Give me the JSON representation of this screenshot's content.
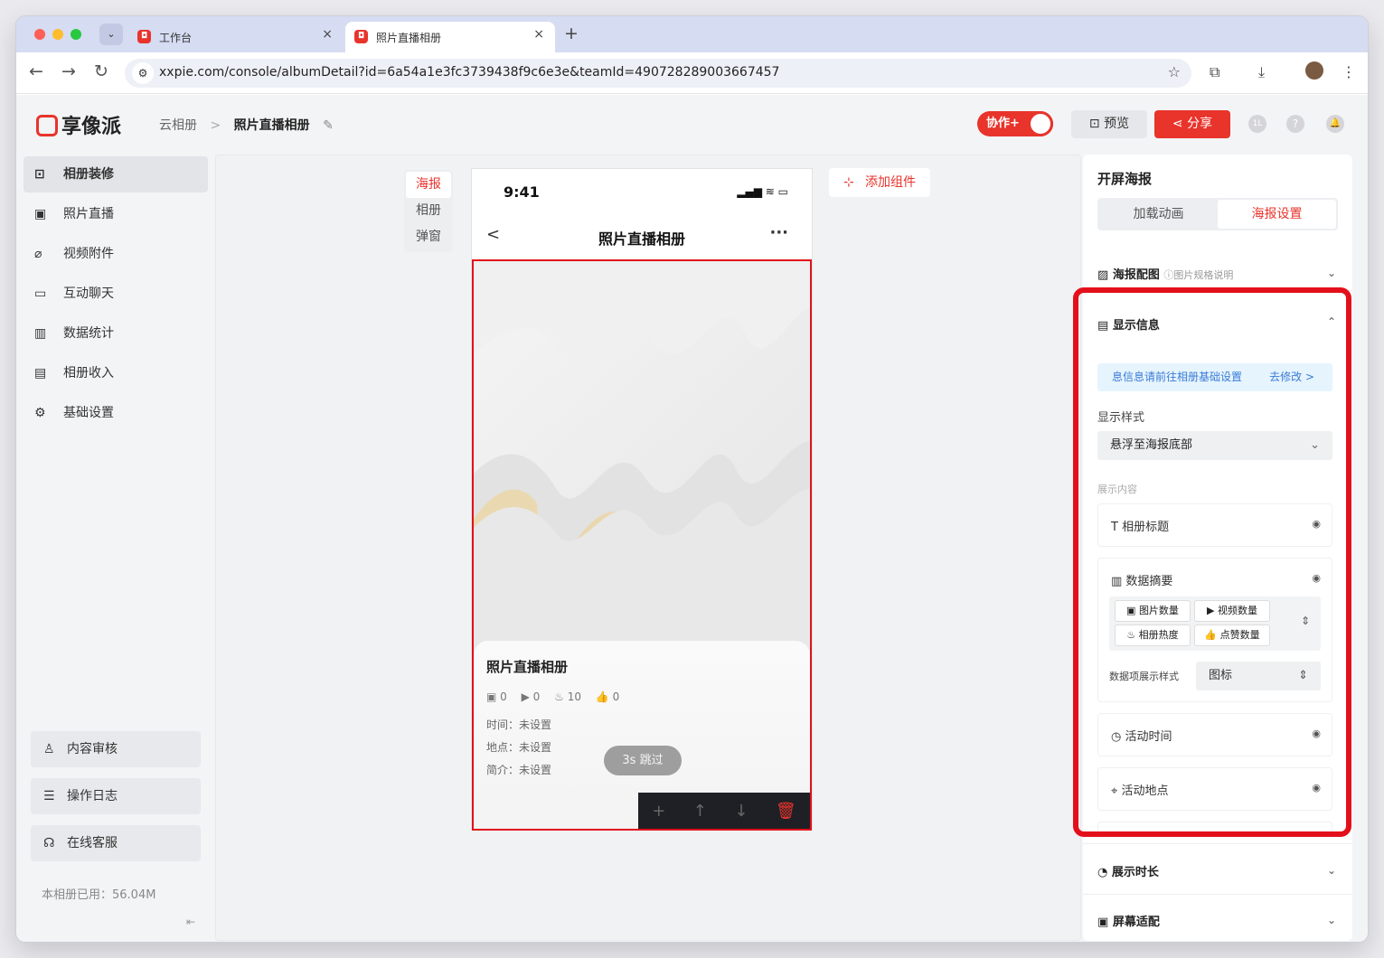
{
  "browser": {
    "tabs": [
      {
        "title": "工作台",
        "close": "×"
      },
      {
        "title": "照片直播相册",
        "close": "×"
      }
    ],
    "new_tab": "+",
    "url": "xxpie.com/console/albumDetail?id=6a54a1e3fc3739438f9c6e3e&teamId=490728289003667457",
    "nav": {
      "back": "←",
      "forward": "→",
      "reload": "↻"
    },
    "icons": {
      "tune": "⚙",
      "star": "☆",
      "extension": "⧉",
      "download": "⤓",
      "menu": "⋮"
    }
  },
  "app": {
    "logo": "享像派",
    "breadcrumb": {
      "root": "云相册",
      "sep": ">",
      "current": "照片直播相册",
      "edit_icon": "✎"
    },
    "header": {
      "collab": "协作+",
      "preview": "预览",
      "share": "分享",
      "user_badge": "1L",
      "help": "?",
      "bell": "🔔"
    },
    "sidebar": {
      "items": [
        {
          "label": "相册装修",
          "icon": "⊡",
          "active": true
        },
        {
          "label": "照片直播",
          "icon": "▣",
          "active": false
        },
        {
          "label": "视频附件",
          "icon": "⌀",
          "active": false
        },
        {
          "label": "互动聊天",
          "icon": "▭",
          "active": false
        },
        {
          "label": "数据统计",
          "icon": "▥",
          "active": false
        },
        {
          "label": "相册收入",
          "icon": "▤",
          "active": false
        },
        {
          "label": "基础设置",
          "icon": "⚙",
          "active": false
        }
      ],
      "bottom": [
        {
          "label": "内容审核",
          "icon": "♙"
        },
        {
          "label": "操作日志",
          "icon": "☰"
        },
        {
          "label": "在线客服",
          "icon": "☊"
        }
      ],
      "usage": "本相册已用：56.04M",
      "collapse_icon": "⇤"
    },
    "canvas": {
      "page_tabs": [
        "海报",
        "相册",
        "弹窗"
      ],
      "active_page_tab": "海报",
      "add_component": "添加组件",
      "add_icon": "⊹",
      "phone": {
        "time": "9:41",
        "status_icons": "▂▄▆ ≋ ▭",
        "back": "<",
        "title": "照片直播相册",
        "more": "···",
        "card": {
          "title": "照片直播相册",
          "stats": [
            "▣ 0",
            "▶ 0",
            "♨ 10",
            "👍 0"
          ],
          "time": "时间：未设置",
          "place": "地点：未设置",
          "intro": "简介：未设置",
          "skip": "3s 跳过"
        },
        "tools": [
          "+",
          "↑",
          "↓",
          "🗑"
        ]
      }
    },
    "panel": {
      "title": "开屏海报",
      "seg": [
        "加载动画",
        "海报设置"
      ],
      "poster_cfg": "海报配图",
      "poster_hint": "ⓘ图片规格说明",
      "display_info": "显示信息",
      "info_note": "息信息请前往相册基础设置",
      "info_link": "去修改 >",
      "style_label": "显示样式",
      "style_value": "悬浮至海报底部",
      "content_label": "展示内容",
      "items": {
        "album_title": "相册标题",
        "data_summary": "数据摘要",
        "event_time": "活动时间",
        "event_place": "活动地点"
      },
      "chips": [
        "图片数量",
        "视频数量",
        "相册热度",
        "点赞数量"
      ],
      "data_style_label": "数据项展示样式",
      "data_style_value": "图标",
      "duration": "展示时长",
      "screen_fit": "屏幕适配",
      "eye": "◉"
    }
  },
  "colors": {
    "accent": "#e8342b",
    "highlight": "#e3101b",
    "info": "#3a7bd5"
  }
}
